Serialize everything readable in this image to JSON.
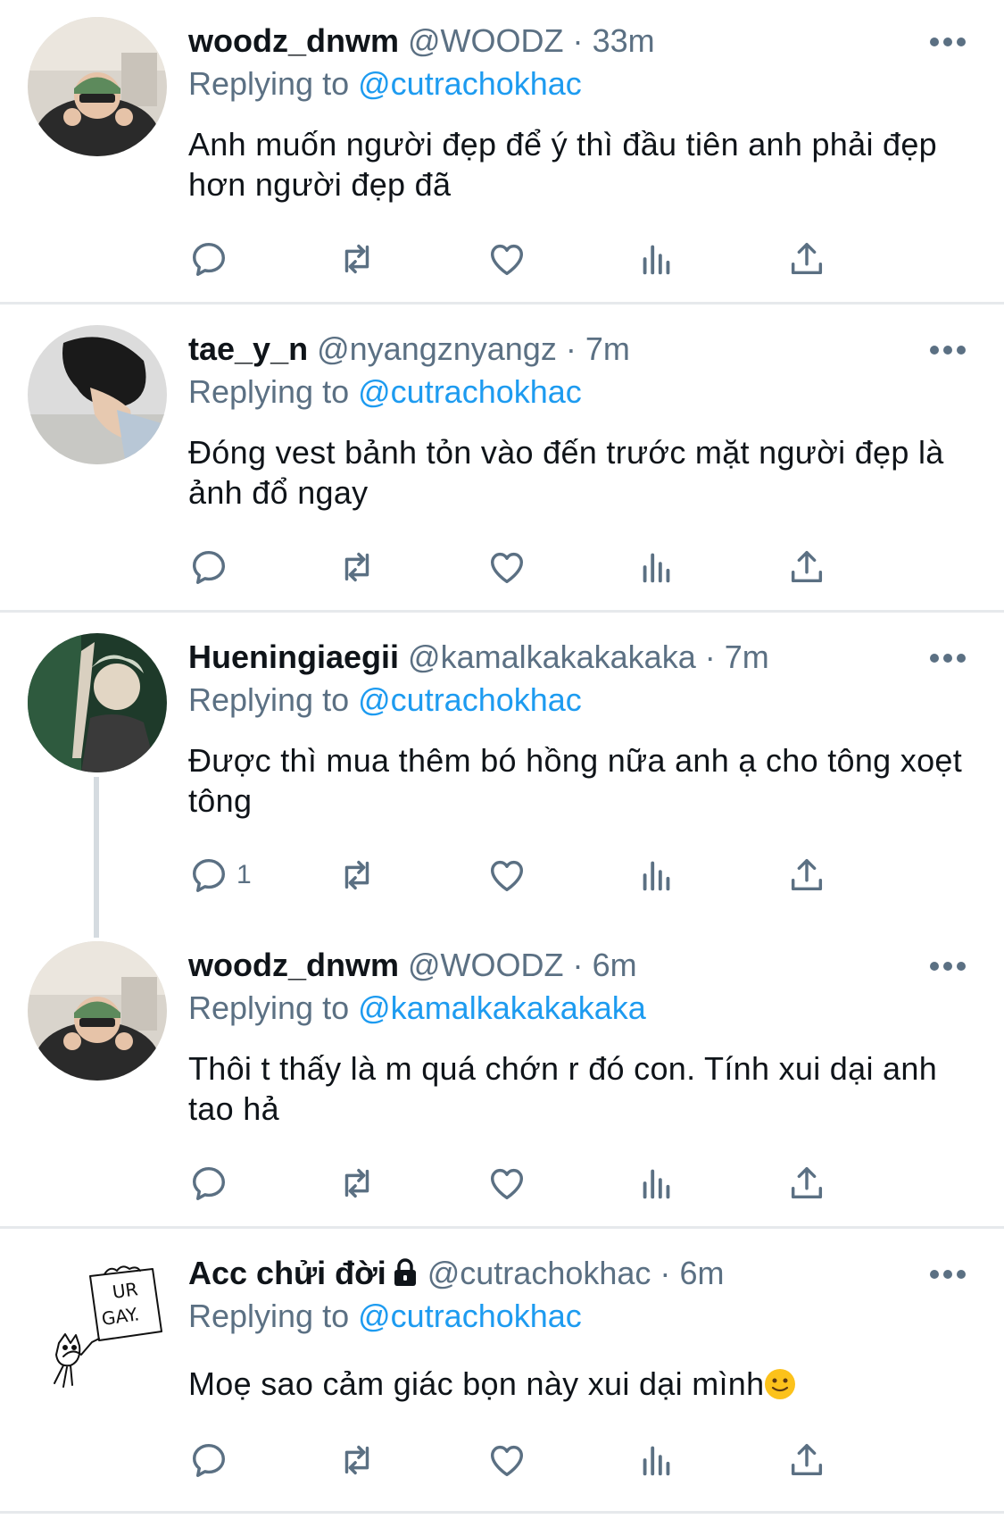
{
  "tweets": [
    {
      "name": "woodz_dnwm",
      "handle": "@WOODZ",
      "dot": "·",
      "time": "33m",
      "replying_prefix": "Replying to",
      "replying_to": "@cutrachokhac",
      "text": "Anh muốn người đẹp để ý thì đầu tiên anh phải đẹp hơn người đẹp đã",
      "reply_count": ""
    },
    {
      "name": "tae_y_n",
      "handle": "@nyangznyangz",
      "dot": "·",
      "time": "7m",
      "replying_prefix": "Replying to",
      "replying_to": "@cutrachokhac",
      "text": "Đóng vest bảnh tỏn vào đến trước mặt người đẹp là ảnh đổ ngay",
      "reply_count": ""
    },
    {
      "name": "Hueningiaegii",
      "handle": "@kamalkakakakaka",
      "dot": "·",
      "time": "7m",
      "replying_prefix": "Replying to",
      "replying_to": "@cutrachokhac",
      "text": "Được thì mua thêm bó hồng nữa anh ạ cho tông xoẹt tông",
      "reply_count": "1"
    },
    {
      "name": "woodz_dnwm",
      "handle": "@WOODZ",
      "dot": "·",
      "time": "6m",
      "replying_prefix": "Replying to",
      "replying_to": "@kamalkakakakaka",
      "text": "Thôi t thấy là m quá chớn r đó con. Tính xui dại anh tao hả",
      "reply_count": ""
    },
    {
      "name": "Acc chửi đời",
      "handle": "@cutrachokhac",
      "dot": "·",
      "time": "6m",
      "replying_prefix": "Replying to",
      "replying_to": "@cutrachokhac",
      "text": "Moẹ sao cảm giác bọn này xui dại mình",
      "reply_count": "",
      "avatar_text": [
        "UR",
        "GAY."
      ]
    }
  ],
  "colors": {
    "name": "#0f1419",
    "secondary": "#5b7083",
    "mention": "#1d9bf0",
    "divider": "#e6e9ec",
    "thread_line": "#d5dbe0"
  },
  "icons": [
    "reply-icon",
    "retweet-icon",
    "like-icon",
    "analytics-icon",
    "share-icon",
    "more-icon",
    "lock-icon",
    "smile-emoji"
  ]
}
